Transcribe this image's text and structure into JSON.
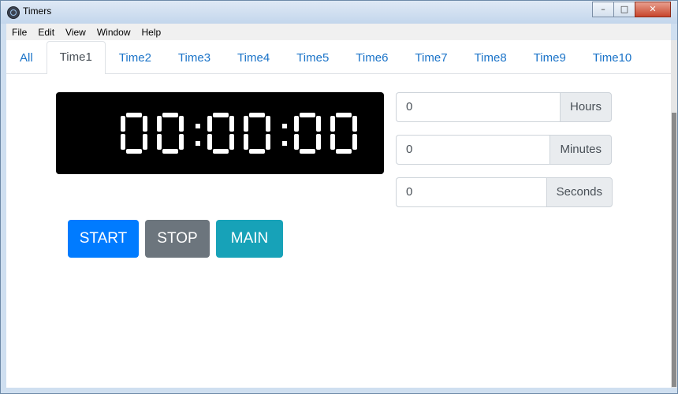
{
  "window": {
    "title": "Timers",
    "controls": {
      "minimize": "–",
      "maximize": "□",
      "close": "✕"
    }
  },
  "menu": [
    "File",
    "Edit",
    "View",
    "Window",
    "Help"
  ],
  "tabs": [
    {
      "label": "All",
      "active": false
    },
    {
      "label": "Time1",
      "active": true
    },
    {
      "label": "Time2",
      "active": false
    },
    {
      "label": "Time3",
      "active": false
    },
    {
      "label": "Time4",
      "active": false
    },
    {
      "label": "Time5",
      "active": false
    },
    {
      "label": "Time6",
      "active": false
    },
    {
      "label": "Time7",
      "active": false
    },
    {
      "label": "Time8",
      "active": false
    },
    {
      "label": "Time9",
      "active": false
    },
    {
      "label": "Time10",
      "active": false
    }
  ],
  "clock": {
    "display": "00:00:00"
  },
  "inputs": [
    {
      "value": "0",
      "unit": "Hours"
    },
    {
      "value": "0",
      "unit": "Minutes"
    },
    {
      "value": "0",
      "unit": "Seconds"
    }
  ],
  "buttons": {
    "start": "START",
    "stop": "STOP",
    "main": "MAIN"
  },
  "colors": {
    "tab_link": "#1a73c8",
    "start": "#007bff",
    "stop": "#6c757d",
    "main": "#17a2b8",
    "clock_bg": "#000000",
    "clock_fg": "#ffffff"
  }
}
